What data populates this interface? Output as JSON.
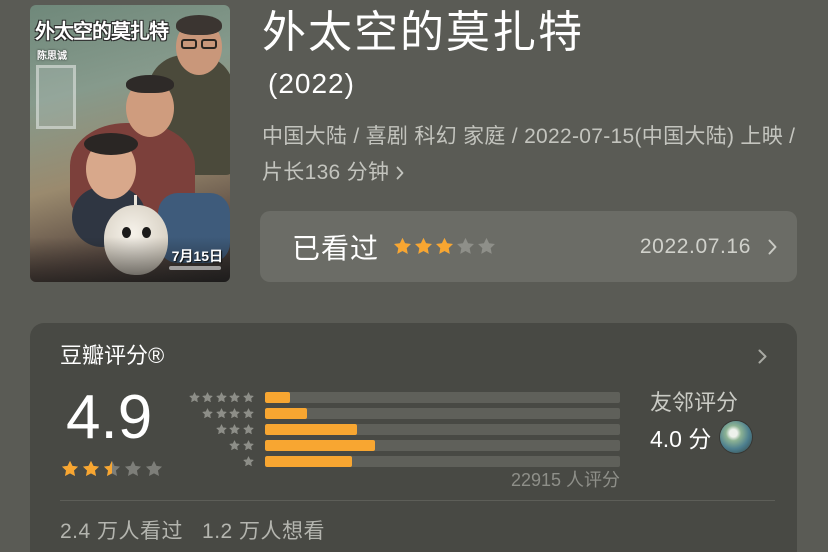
{
  "movie": {
    "title": "外太空的莫扎特",
    "year": "(2022)",
    "meta": "中国大陆 / 喜剧 科幻 家庭 / 2022-07-15(中国大陆) 上映 / 片长136 分钟",
    "meta_icon": "chevron-right-icon"
  },
  "poster": {
    "title_lettering": "外太空的莫扎特",
    "director_lettering": "陈思诚",
    "release_lettering": "7月15日"
  },
  "watched": {
    "label": "已看过",
    "my_rating": 3,
    "max_rating": 5,
    "date": "2022.07.16",
    "icon": "chevron-right-icon"
  },
  "rating": {
    "heading": "豆瓣评分®",
    "heading_icon": "chevron-right-icon",
    "score": "4.9",
    "score_stars": 2.5,
    "max_stars": 5,
    "distribution": [
      {
        "stars": 5,
        "percent": 7.0
      },
      {
        "stars": 4,
        "percent": 11.8
      },
      {
        "stars": 3,
        "percent": 25.8
      },
      {
        "stars": 2,
        "percent": 30.9
      },
      {
        "stars": 1,
        "percent": 24.5
      }
    ],
    "count_text": "22915 人评分",
    "friends_label": "友邻评分",
    "friends_score": "4.0 分",
    "friends_avatar_icon": "user-avatar",
    "watched_count": "2.4 万人看过",
    "wish_count": "1.2 万人想看"
  },
  "colors": {
    "page_background": "#5a5b55",
    "card_background": "#484944",
    "star_on": "#f8a631",
    "star_off": "#7d7e79",
    "star_off_on_box": "#8e8f89",
    "distribution_star": "#8d8e88",
    "bar_fill": "#f8a631"
  }
}
